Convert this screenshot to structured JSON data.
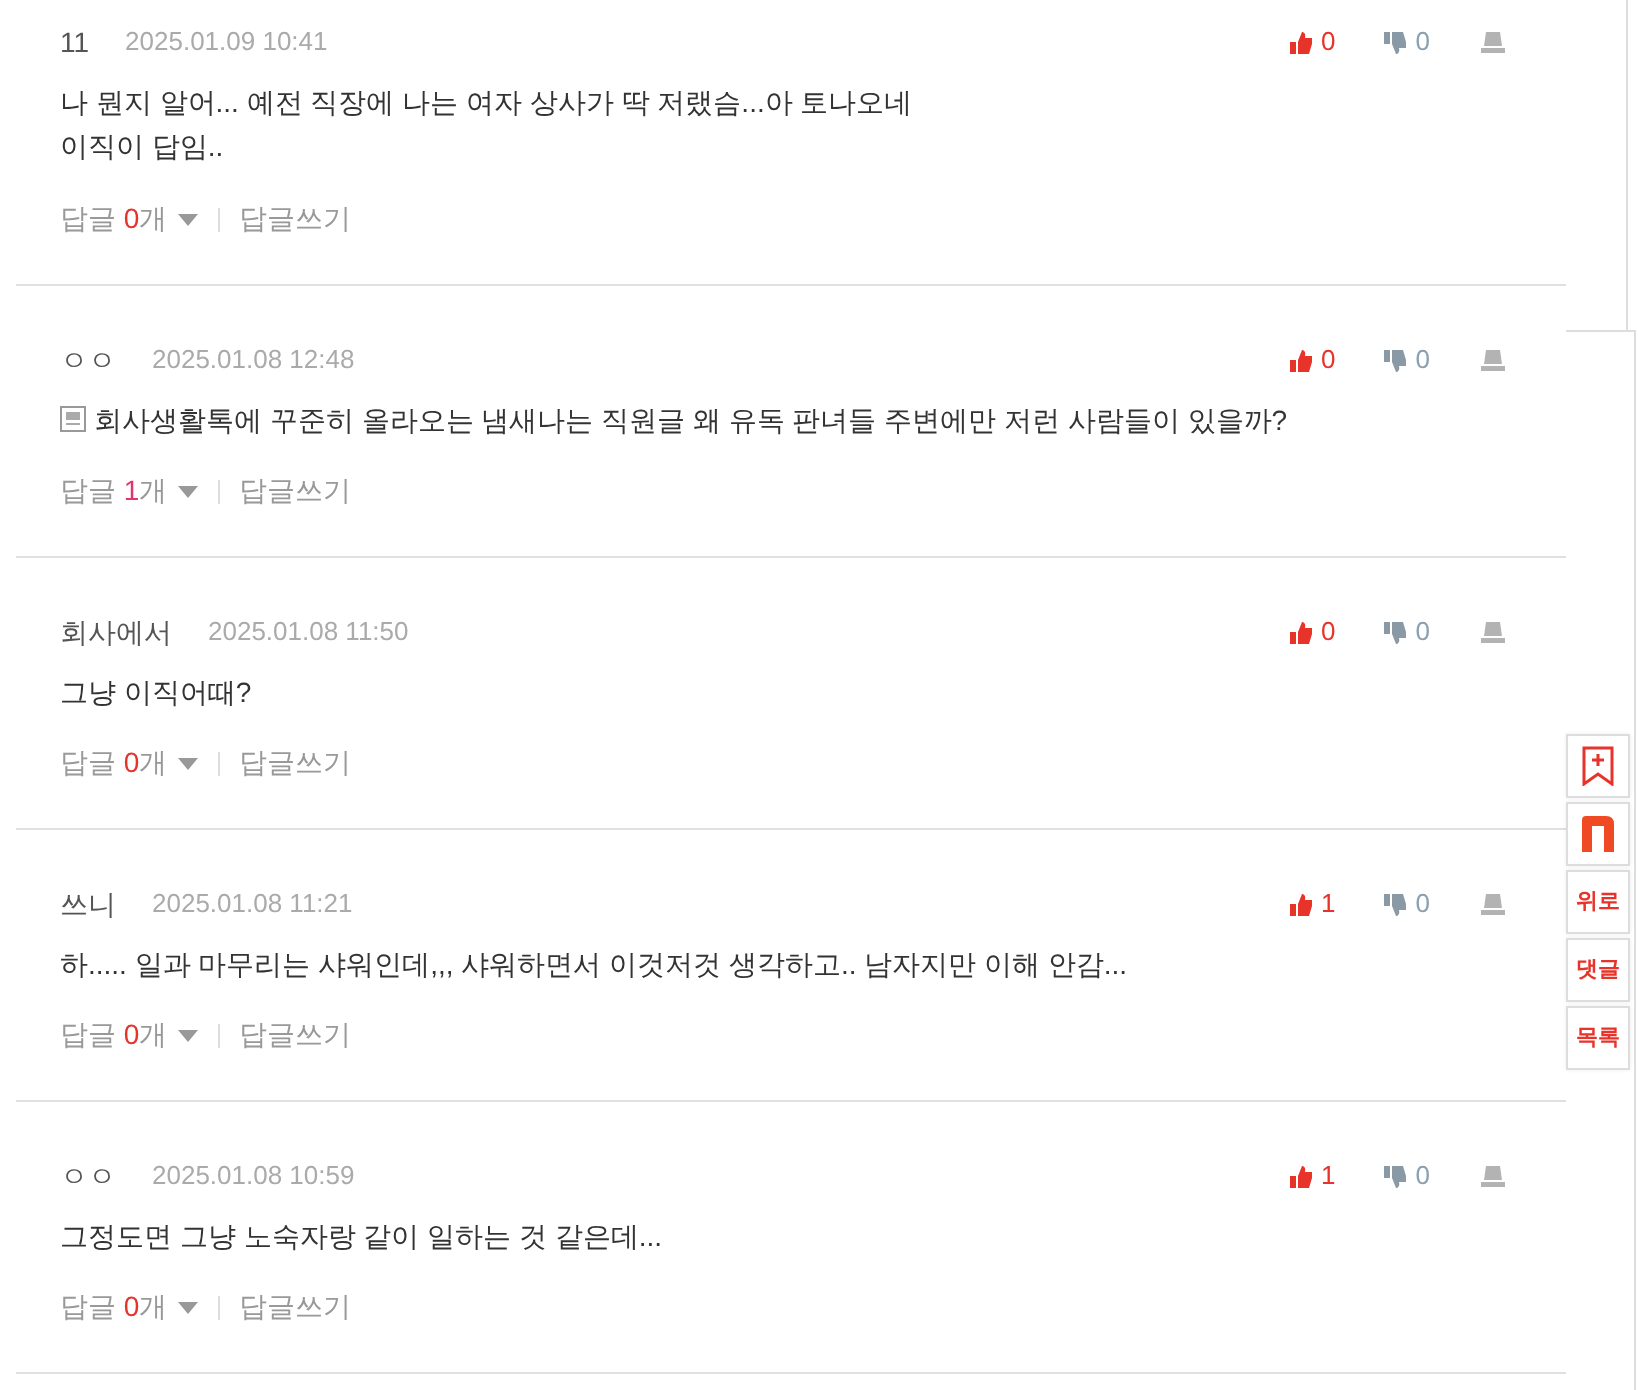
{
  "comments": [
    {
      "author": "11",
      "time": "2025.01.09 10:41",
      "has_link_icon": false,
      "lines": [
        "나 뭔지 알어... 예전 직장에 나는 여자 상사가 딱 저랬슴...아 토나오네",
        "이직이 답임.."
      ],
      "likes": "0",
      "dislikes": "0",
      "reply_label": "답글",
      "reply_count": "0",
      "reply_unit": "개",
      "write_label": "답글쓰기"
    },
    {
      "author": "ㅇㅇ",
      "time": "2025.01.08 12:48",
      "has_link_icon": true,
      "lines": [
        "회사생활톡에 꾸준히 올라오는 냄새나는 직원글 왜 유독 판녀들 주변에만 저런 사람들이 있을까?"
      ],
      "likes": "0",
      "dislikes": "0",
      "reply_label": "답글",
      "reply_count": "1",
      "reply_unit": "개",
      "write_label": "답글쓰기"
    },
    {
      "author": "회사에서",
      "time": "2025.01.08 11:50",
      "has_link_icon": false,
      "lines": [
        "그냥 이직어때?"
      ],
      "likes": "0",
      "dislikes": "0",
      "reply_label": "답글",
      "reply_count": "0",
      "reply_unit": "개",
      "write_label": "답글쓰기"
    },
    {
      "author": "쓰니",
      "time": "2025.01.08 11:21",
      "has_link_icon": false,
      "lines": [
        "하..... 일과 마무리는 샤워인데,,, 샤워하면서 이것저것 생각하고.. 남자지만 이해 안감..."
      ],
      "likes": "1",
      "dislikes": "0",
      "reply_label": "답글",
      "reply_count": "0",
      "reply_unit": "개",
      "write_label": "답글쓰기"
    },
    {
      "author": "ㅇㅇ",
      "time": "2025.01.08 10:59",
      "has_link_icon": false,
      "lines": [
        "그정도면 그냥 노숙자랑 같이 일하는 것 같은데..."
      ],
      "likes": "1",
      "dislikes": "0",
      "reply_label": "답글",
      "reply_count": "0",
      "reply_unit": "개",
      "write_label": "답글쓰기"
    }
  ],
  "side_buttons": [
    {
      "kind": "bookmark"
    },
    {
      "kind": "logo"
    },
    {
      "kind": "text",
      "label": "위로"
    },
    {
      "kind": "text",
      "label": "댓글"
    },
    {
      "kind": "text",
      "label": "목록"
    }
  ]
}
